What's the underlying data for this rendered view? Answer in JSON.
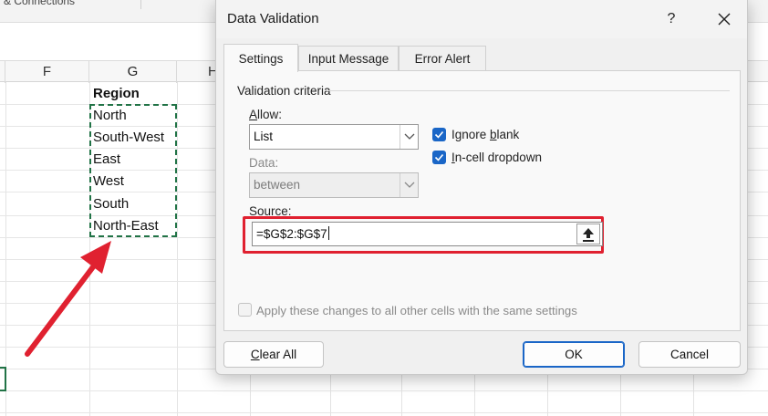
{
  "spreadsheet": {
    "ribbon_label": "& Connections",
    "columns": [
      "F",
      "G",
      "H"
    ],
    "cells": [
      "Region",
      "North",
      "South-West",
      "East",
      "West",
      "South",
      "North-East"
    ]
  },
  "dialog": {
    "title": "Data Validation",
    "help_label": "?",
    "tabs": [
      {
        "label": "Settings",
        "active": true
      },
      {
        "label": "Input Message",
        "active": false
      },
      {
        "label": "Error Alert",
        "active": false
      }
    ],
    "validation_criteria_label": "Validation criteria",
    "allow": {
      "label_first": "A",
      "label_rest": "llow:",
      "value": "List"
    },
    "ignore_blank": {
      "label_pre": "Ignore ",
      "label_key": "b",
      "label_post": "lank",
      "checked": true
    },
    "in_cell_dropdown": {
      "label_key": "I",
      "label_post": "n-cell dropdown",
      "checked": true
    },
    "data": {
      "label": "Data:",
      "value": "between",
      "enabled": false
    },
    "source": {
      "label_first": "S",
      "label_rest": "ource:",
      "value": "=$G$2:$G$7"
    },
    "apply_all": {
      "label": "Apply these changes to all other cells with the same settings",
      "checked": false,
      "enabled": false
    },
    "buttons": {
      "clear_all_first": "C",
      "clear_all_rest": "lear All",
      "ok": "OK",
      "cancel": "Cancel"
    }
  },
  "colors": {
    "accent": "#1a66c7",
    "highlight": "#e02130",
    "excel_green": "#217346"
  }
}
